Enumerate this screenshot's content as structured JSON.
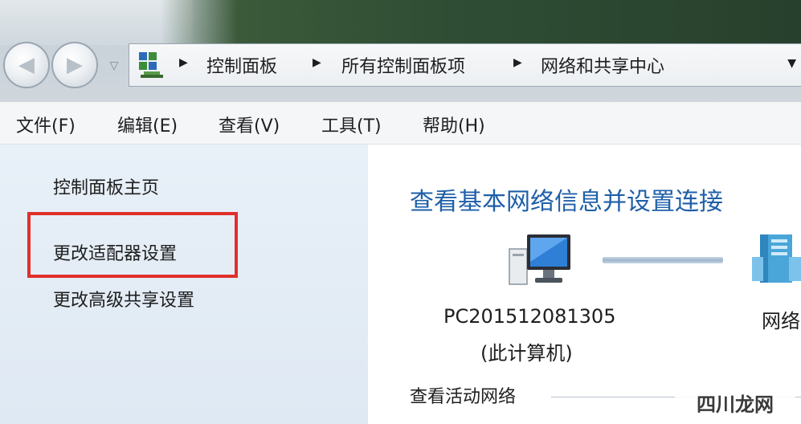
{
  "address_bar": {
    "crumbs": [
      "控制面板",
      "所有控制面板项",
      "网络和共享中心"
    ]
  },
  "menu": {
    "items": [
      "文件(F)",
      "编辑(E)",
      "查看(V)",
      "工具(T)",
      "帮助(H)"
    ]
  },
  "sidebar": {
    "items": [
      "控制面板主页",
      "更改适配器设置",
      "更改高级共享设置"
    ]
  },
  "main": {
    "title": "查看基本网络信息并设置连接",
    "computer_name": "PC201512081305",
    "computer_sub": "(此计算机)",
    "network_label": "网络",
    "active_networks_title": "查看活动网络"
  },
  "watermark": "四川龙网",
  "colors": {
    "title_blue": "#1f5fa8",
    "highlight_red": "#e0302a",
    "sidebar_bg": "#e3ecf5"
  }
}
